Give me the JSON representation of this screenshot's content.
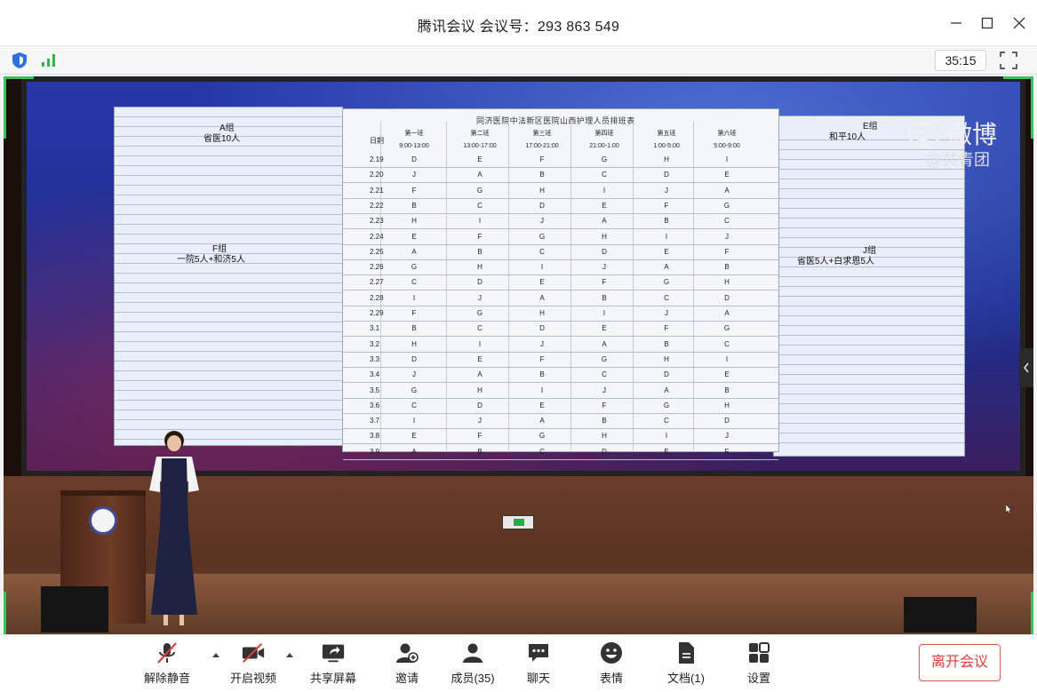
{
  "window": {
    "title": "腾讯会议 会议号：293 863 549",
    "minimize_icon": "minimize-icon",
    "maximize_icon": "maximize-icon",
    "close_icon": "close-icon"
  },
  "infobar": {
    "security_icon": "shield-icon",
    "network_icon": "signal-icon",
    "timer": "35:15",
    "fullscreen_icon": "fullscreen-icon"
  },
  "video": {
    "watermark": {
      "brand": "微博",
      "sub": "@共青团"
    },
    "sheet_title": "同济医院中法新区医院山西护理人员排班表",
    "left_groups": {
      "a": "A组",
      "a_sub": "省医10人",
      "f": "F组",
      "f_sub": "一院5人+和济5人"
    },
    "right_groups": {
      "e": "E组",
      "e_sub": "和平10人",
      "j": "J组",
      "j_sub": "省医5人+白求恩5人"
    },
    "schedule": {
      "header_date": "日期",
      "shifts": [
        {
          "name": "第一班",
          "time": "9:00-13:00"
        },
        {
          "name": "第二班",
          "time": "13:00-17:00"
        },
        {
          "name": "第三班",
          "time": "17:00-21:00"
        },
        {
          "name": "第四班",
          "time": "21:00-1:00"
        },
        {
          "name": "第五班",
          "time": "1:00-5:00"
        },
        {
          "name": "第六班",
          "time": "5:00-9:00"
        }
      ],
      "rows": [
        {
          "date": "2.19",
          "cells": [
            "D",
            "E",
            "F",
            "G",
            "H",
            "I"
          ]
        },
        {
          "date": "2.20",
          "cells": [
            "J",
            "A",
            "B",
            "C",
            "D",
            "E"
          ]
        },
        {
          "date": "2.21",
          "cells": [
            "F",
            "G",
            "H",
            "I",
            "J",
            "A"
          ]
        },
        {
          "date": "2.22",
          "cells": [
            "B",
            "C",
            "D",
            "E",
            "F",
            "G"
          ]
        },
        {
          "date": "2.23",
          "cells": [
            "H",
            "I",
            "J",
            "A",
            "B",
            "C"
          ]
        },
        {
          "date": "2.24",
          "cells": [
            "E",
            "F",
            "G",
            "H",
            "I",
            "J"
          ]
        },
        {
          "date": "2.25",
          "cells": [
            "A",
            "B",
            "C",
            "D",
            "E",
            "F"
          ]
        },
        {
          "date": "2.26",
          "cells": [
            "G",
            "H",
            "I",
            "J",
            "A",
            "B"
          ]
        },
        {
          "date": "2.27",
          "cells": [
            "C",
            "D",
            "E",
            "F",
            "G",
            "H"
          ]
        },
        {
          "date": "2.28",
          "cells": [
            "I",
            "J",
            "A",
            "B",
            "C",
            "D"
          ]
        },
        {
          "date": "2.29",
          "cells": [
            "F",
            "G",
            "H",
            "I",
            "J",
            "A"
          ]
        },
        {
          "date": "3.1",
          "cells": [
            "B",
            "C",
            "D",
            "E",
            "F",
            "G"
          ]
        },
        {
          "date": "3.2",
          "cells": [
            "H",
            "I",
            "J",
            "A",
            "B",
            "C"
          ]
        },
        {
          "date": "3.3",
          "cells": [
            "D",
            "E",
            "F",
            "G",
            "H",
            "I"
          ]
        },
        {
          "date": "3.4",
          "cells": [
            "J",
            "A",
            "B",
            "C",
            "D",
            "E"
          ]
        },
        {
          "date": "3.5",
          "cells": [
            "G",
            "H",
            "I",
            "J",
            "A",
            "B"
          ]
        },
        {
          "date": "3.6",
          "cells": [
            "C",
            "D",
            "E",
            "F",
            "G",
            "H"
          ]
        },
        {
          "date": "3.7",
          "cells": [
            "I",
            "J",
            "A",
            "B",
            "C",
            "D"
          ]
        },
        {
          "date": "3.8",
          "cells": [
            "E",
            "F",
            "G",
            "H",
            "I",
            "J"
          ]
        },
        {
          "date": "3.9",
          "cells": [
            "A",
            "B",
            "C",
            "D",
            "E",
            "F"
          ]
        }
      ]
    }
  },
  "toolbar": {
    "items": [
      {
        "key": "unmute",
        "label": "解除静音",
        "icon": "mic-muted-icon"
      },
      {
        "key": "video",
        "label": "开启视频",
        "icon": "camera-off-icon"
      },
      {
        "key": "share",
        "label": "共享屏幕",
        "icon": "share-screen-icon"
      },
      {
        "key": "invite",
        "label": "邀请",
        "icon": "invite-icon"
      },
      {
        "key": "members",
        "label": "成员(35)",
        "icon": "members-icon"
      },
      {
        "key": "chat",
        "label": "聊天",
        "icon": "chat-icon"
      },
      {
        "key": "emoji",
        "label": "表情",
        "icon": "emoji-icon"
      },
      {
        "key": "docs",
        "label": "文档(1)",
        "icon": "document-icon"
      },
      {
        "key": "settings",
        "label": "设置",
        "icon": "settings-icon"
      }
    ],
    "leave_label": "离开会议"
  }
}
